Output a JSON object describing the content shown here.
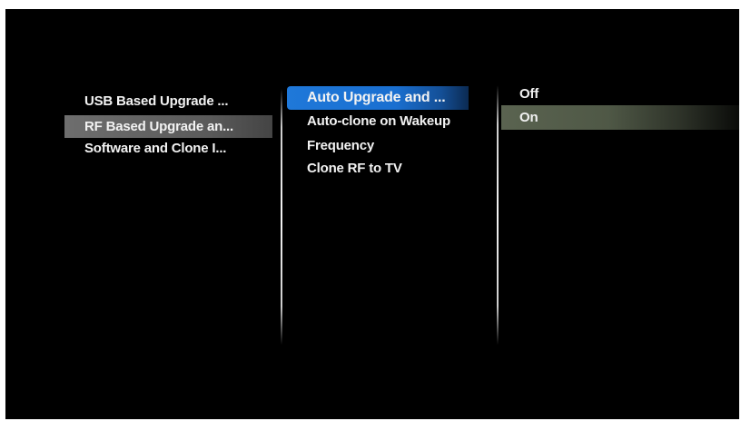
{
  "menu": {
    "level1": {
      "items": [
        {
          "label": "USB Based Upgrade ..."
        },
        {
          "label": "RF Based Upgrade an..."
        },
        {
          "label": "Software and Clone I..."
        }
      ],
      "selected_index": 1
    },
    "level2": {
      "items": [
        {
          "label": "Auto Upgrade and ..."
        },
        {
          "label": "Auto-clone on Wakeup"
        },
        {
          "label": "Frequency"
        },
        {
          "label": "Clone RF to TV"
        }
      ],
      "focused_index": 0
    },
    "level3": {
      "items": [
        {
          "label": "Off"
        },
        {
          "label": "On"
        }
      ],
      "selected_index": 1
    }
  },
  "colors": {
    "background": "#000000",
    "text": "#f2f2f2",
    "focus_highlight": "#1f78d9",
    "selected_highlight": "#5a6350",
    "parent_highlight": "#6e6e6e"
  }
}
